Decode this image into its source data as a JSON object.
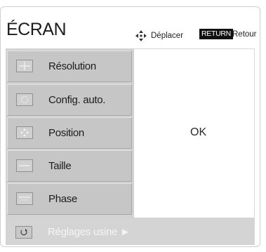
{
  "menu": {
    "title": "ÉCRAN",
    "help": {
      "move_icon": "four-way-arrow-icon",
      "move_label": "Déplacer",
      "return_key": "RETURN",
      "return_label": "Retour"
    },
    "items": [
      {
        "label": "Résolution",
        "icon": "resolution-icon"
      },
      {
        "label": "Config. auto.",
        "icon": "auto-config-icon"
      },
      {
        "label": "Position",
        "icon": "position-icon"
      },
      {
        "label": "Taille",
        "icon": "size-icon"
      },
      {
        "label": "Phase",
        "icon": "phase-icon"
      }
    ],
    "detail_value": "OK",
    "reset": {
      "label": "Réglages usine ►",
      "icon": "reset-icon"
    }
  },
  "colors": {
    "item_bg": "#c6c6c6",
    "panel_bg": "#d2d2d2",
    "badge_bg": "#111111"
  }
}
